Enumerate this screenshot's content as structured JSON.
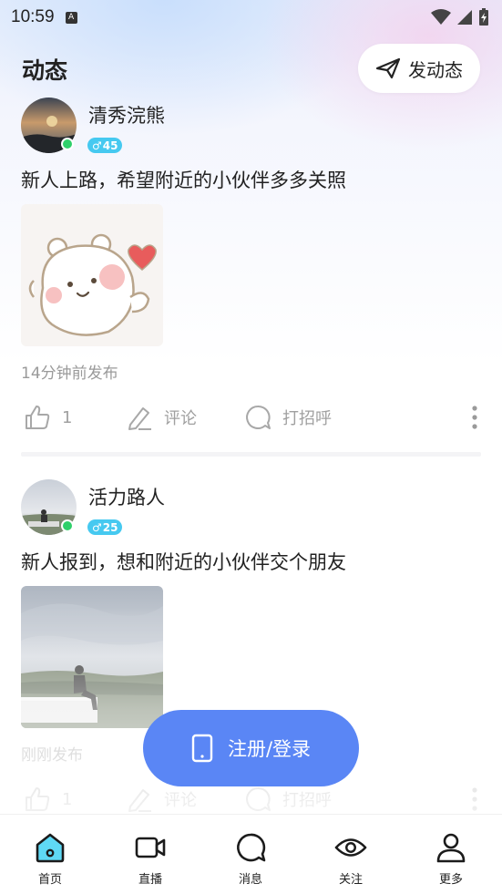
{
  "status_bar": {
    "time": "10:59",
    "indicator_letter": "A",
    "icons": [
      "wifi-icon",
      "signal-icon",
      "battery-charging-icon"
    ]
  },
  "header": {
    "title": "动态",
    "post_button_label": "发动态",
    "post_button_icon": "paper-plane-icon"
  },
  "posts": [
    {
      "username": "清秀浣熊",
      "gender_symbol": "♂",
      "age": "45",
      "text": "新人上路，希望附近的小伙伴多多关照",
      "image": "cartoon-bear-sticker",
      "time": "14分钟前发布",
      "likes": "1",
      "comment_label": "评论",
      "greet_label": "打招呼"
    },
    {
      "username": "活力路人",
      "gender_symbol": "♂",
      "age": "25",
      "text": "新人报到，想和附近的小伙伴交个朋友",
      "image": "man-sitting-outdoors-photo",
      "time": "刚刚发布",
      "likes": "1",
      "comment_label": "评论",
      "greet_label": "打招呼"
    }
  ],
  "login_button": {
    "label": "注册/登录",
    "icon": "phone-icon"
  },
  "bottom_nav": [
    {
      "label": "首页",
      "icon": "home-icon",
      "active": true
    },
    {
      "label": "直播",
      "icon": "video-camera-icon",
      "active": false
    },
    {
      "label": "消息",
      "icon": "chat-bubble-icon",
      "active": false
    },
    {
      "label": "关注",
      "icon": "eye-icon",
      "active": false
    },
    {
      "label": "更多",
      "icon": "person-icon",
      "active": false
    }
  ],
  "colors": {
    "accent": "#5a86f5",
    "online": "#2fd06a",
    "gender_badge": "#46c9f0",
    "nav_active_fill": "#5fd9f5"
  }
}
